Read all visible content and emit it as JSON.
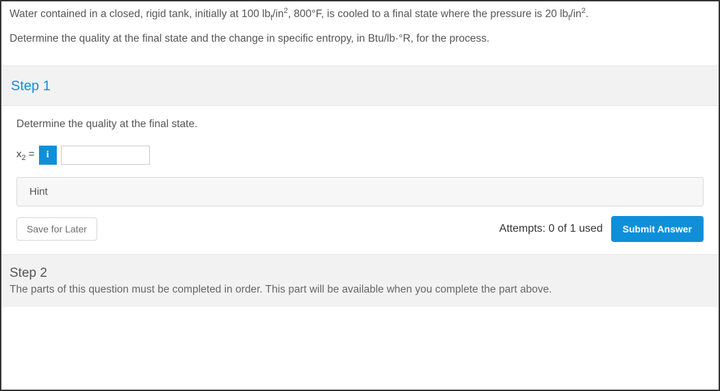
{
  "problem": {
    "line1_pre": "Water contained in a closed, rigid tank, initially at 100 lb",
    "line1_sub1": "f",
    "line1_mid1": "/in",
    "line1_sup1": "2",
    "line1_mid2": ", 800°F, is cooled to a final state where the pressure is 20 lb",
    "line1_sub2": "f",
    "line1_mid3": "/in",
    "line1_sup2": "2",
    "line1_end": ".",
    "line2": "Determine the quality at the final state and the change in specific entropy, in Btu/lb·°R, for the process."
  },
  "step1": {
    "title": "Step 1",
    "instruction": "Determine the quality at the final state.",
    "answer_label_prefix": "x",
    "answer_label_sub": "2",
    "answer_label_suffix": " = ",
    "info_icon_glyph": "i",
    "input_value": "",
    "hint_label": "Hint",
    "save_label": "Save for Later",
    "attempts_text": "Attempts: 0 of 1 used",
    "submit_label": "Submit Answer"
  },
  "step2": {
    "title": "Step 2",
    "locked_message": "The parts of this question must be completed in order. This part will be available when you complete the part above."
  },
  "colors": {
    "accent": "#0f8fd9",
    "text": "#555555",
    "panel_bg": "#f2f2f2",
    "border": "#e4e4e4"
  }
}
